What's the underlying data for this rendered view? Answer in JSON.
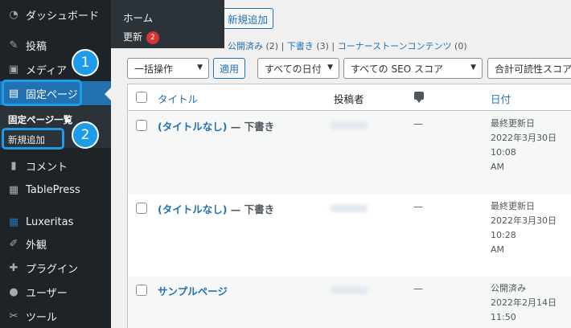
{
  "sidebar": {
    "dashboard": "ダッシュボード",
    "posts": "投稿",
    "media": "メディア",
    "pages": "固定ページ",
    "submenu_head": "固定ページ一覧",
    "submenu_add": "新規追加",
    "comments": "コメント",
    "tablepress": "TablePress",
    "luxeritas": "Luxeritas",
    "appearance": "外観",
    "plugins": "プラグイン",
    "users": "ユーザー",
    "tools": "ツール"
  },
  "flyout": {
    "home": "ホーム",
    "updates": "更新",
    "updates_count": "2"
  },
  "callouts": {
    "one": "1",
    "two": "2"
  },
  "main": {
    "add_new": "新規追加",
    "views": {
      "published": "公開済み",
      "published_count": "(2)",
      "sep1": "|",
      "drafts": "下書き",
      "drafts_count": "(3)",
      "sep2": "|",
      "cornerstone": "コーナーストーンコンテンツ",
      "cornerstone_count": "(0)"
    },
    "bulk_action": "一括操作",
    "apply": "適用",
    "all_dates": "すべての日付",
    "seo_scores": "すべての SEO スコア",
    "readability": "合計可読性スコア"
  },
  "table": {
    "col_title": "タイトル",
    "col_author": "投稿者",
    "col_date": "日付",
    "rows": [
      {
        "title": "(タイトルなし)",
        "state": " — 下書き",
        "comments": "—",
        "date_label": "最終更新日",
        "date": "2022年3月30日 10:08",
        "time": "AM"
      },
      {
        "title": "(タイトルなし)",
        "state": " — 下書き",
        "comments": "—",
        "date_label": "最終更新日",
        "date": "2022年3月30日 10:28",
        "time": "AM"
      },
      {
        "title": "サンプルページ",
        "state": "",
        "comments": "—",
        "date_label": "公開済み",
        "date": "2022年2月14日 11:50",
        "time": "AM"
      }
    ]
  },
  "colors": {
    "sidebar_bg": "#1d2327",
    "accent": "#2271b1",
    "callout": "#1e9be9",
    "badge": "#d63638"
  }
}
